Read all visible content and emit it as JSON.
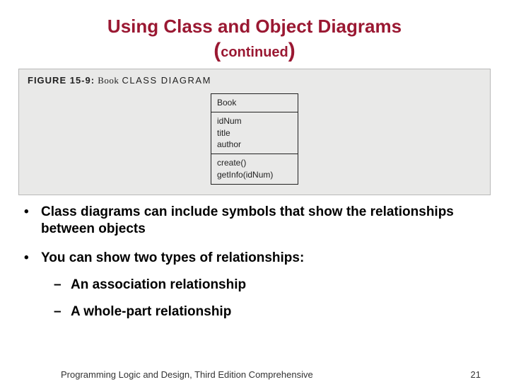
{
  "title": "Using Class and Object Diagrams",
  "subtitle_word": "continued",
  "figure": {
    "number": "FIGURE 15-9:",
    "word": "Book",
    "rest": "CLASS DIAGRAM",
    "class_name": "Book",
    "attributes": [
      "idNum",
      "title",
      "author"
    ],
    "methods": [
      "create()",
      "getInfo(idNum)"
    ]
  },
  "bullets": [
    "Class diagrams can include symbols that show the relationships between objects",
    "You can show two types of relationships:"
  ],
  "subbullets": [
    "An association relationship",
    "A whole-part relationship"
  ],
  "footer_text": "Programming Logic and Design, Third Edition Comprehensive",
  "page_number": "21"
}
